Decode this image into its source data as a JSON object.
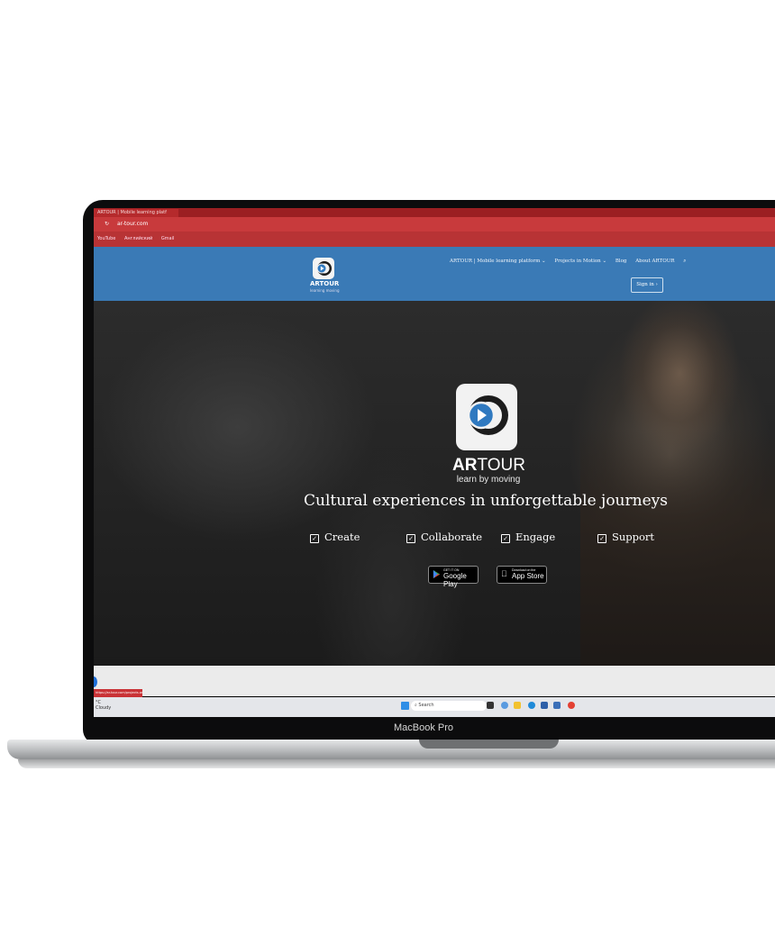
{
  "device": {
    "model": "MacBook Pro"
  },
  "browser": {
    "tab_title": "ARTOUR | Mobile learning platf",
    "url": "ar-tour.com",
    "bookmarks": [
      "YouTube",
      "Английский",
      "Gmail"
    ]
  },
  "site": {
    "logo_name": "ARTOUR",
    "logo_tagline": "learning moving",
    "menu": [
      "ARTOUR | Mobile learning platform ⌄",
      "Projects in Motion ⌄",
      "Blog",
      "About ARTOUR"
    ],
    "signin_label": "Sign in ›"
  },
  "hero": {
    "brand_bold": "AR",
    "brand_rest": "TOUR",
    "brand_tagline": "learn by moving",
    "headline": "Cultural experiences in unforgettable journeys",
    "features": [
      "Create",
      "Collaborate",
      "Engage",
      "Support"
    ],
    "stores": [
      {
        "small": "GET IT ON",
        "big": "Google Play",
        "icon": "google-play-icon"
      },
      {
        "small": "Download on the",
        "big": "App Store",
        "icon": "apple-icon"
      }
    ]
  },
  "taskbar": {
    "status_link": "https://ar-tour.com/projects.aspx",
    "weather_temp": "°C",
    "weather_desc": "Cloudy",
    "search_placeholder": "Search"
  },
  "colors": {
    "browser_red": "#c83a3c",
    "header_blue": "#3a7ab6",
    "logo_play_blue": "#2f79c0"
  }
}
